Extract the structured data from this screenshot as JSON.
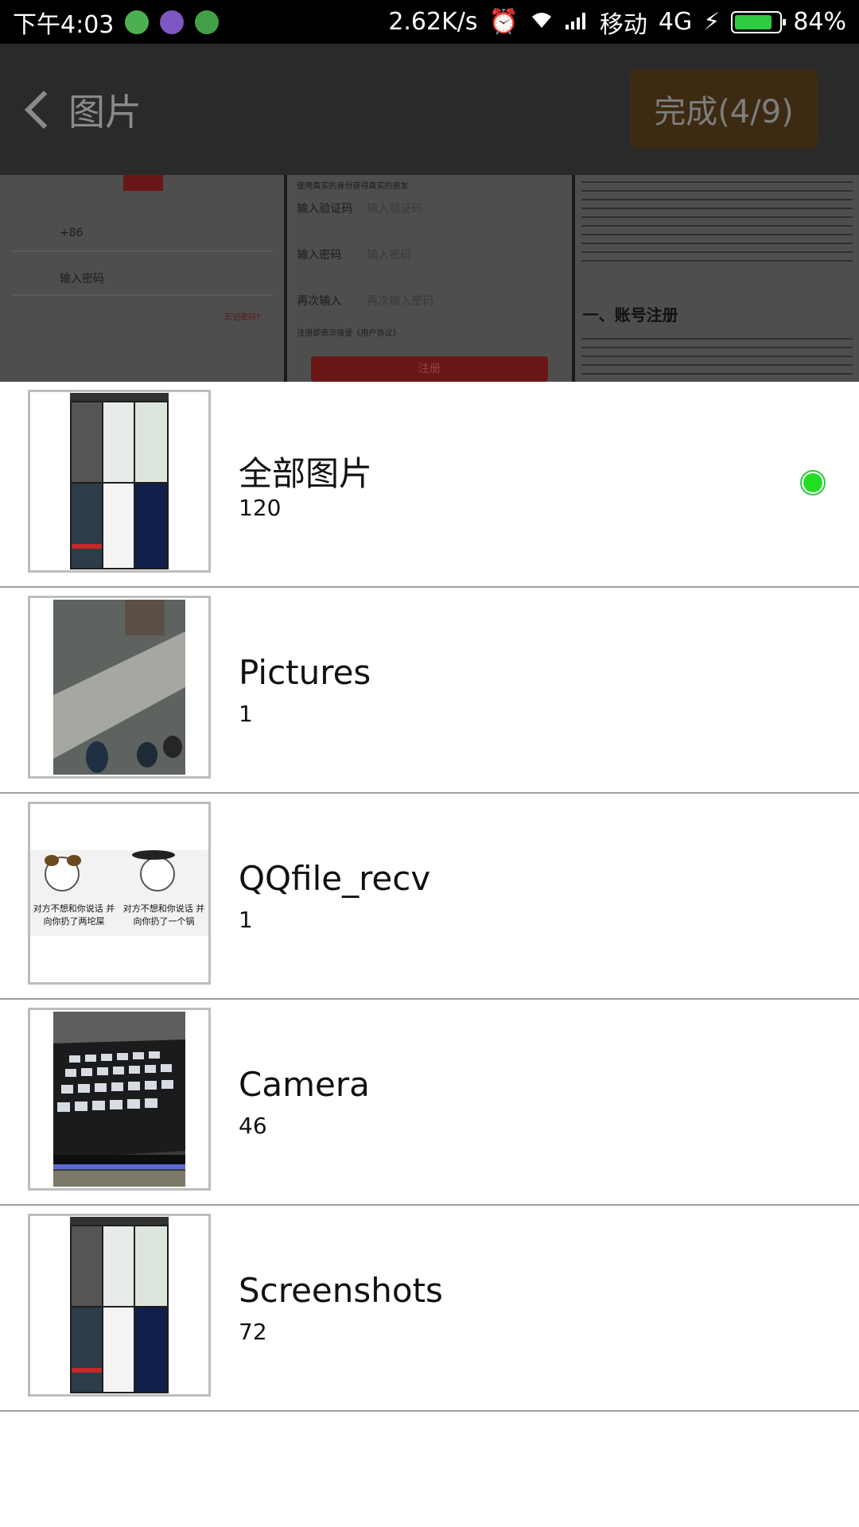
{
  "status_bar": {
    "time": "下午4:03",
    "speed": "2.62K/s",
    "carrier": "移动",
    "network": "4G",
    "battery": "84%",
    "battery_level": 0.84
  },
  "header": {
    "back_label": "图片",
    "done_label": "完成(4/9)"
  },
  "background": {
    "login": {
      "country_code": "+86",
      "password_placeholder": "输入密码",
      "forgot": "忘记密码?"
    },
    "register": {
      "hint": "使用真实的身份获得真实的朋友",
      "code_label": "输入验证码",
      "code_placeholder": "输入验证码",
      "password_label": "输入密码",
      "password_placeholder": "输入密码",
      "confirm_label": "再次输入",
      "confirm_placeholder": "再次输入密码",
      "agreement": "注册即表示接受《用户协议》",
      "register_button": "注册"
    },
    "terms": {
      "heading": "一、账号注册"
    }
  },
  "albums": [
    {
      "name": "全部图片",
      "count": "120",
      "selected": true,
      "thumb": "screenshot-collage-icon"
    },
    {
      "name": "Pictures",
      "count": "1",
      "selected": false,
      "thumb": "ground-photo-icon"
    },
    {
      "name": "QQfile_recv",
      "count": "1",
      "selected": false,
      "thumb": "meme-image-icon"
    },
    {
      "name": "Camera",
      "count": "46",
      "selected": false,
      "thumb": "keyboard-photo-icon"
    },
    {
      "name": "Screenshots",
      "count": "72",
      "selected": false,
      "thumb": "screenshot-collage-icon"
    }
  ],
  "meme_captions": {
    "left": "对方不想和你说话 并向你扔了两坨屎",
    "right": "对方不想和你说话 并向你扔了一个锅"
  },
  "colors": {
    "accent_green": "#22dd22",
    "done_button_bg": "#3d2a12",
    "topbar_bg": "#2a2a2a"
  }
}
